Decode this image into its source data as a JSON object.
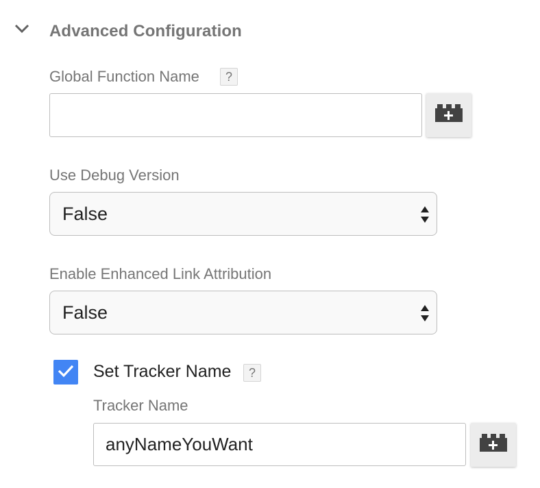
{
  "section": {
    "title": "Advanced Configuration",
    "toggle_icon": "chevron-down-icon"
  },
  "global_function": {
    "label": "Global Function Name",
    "help": "?",
    "value": "",
    "variable_button_icon": "add-variable-icon"
  },
  "debug_version": {
    "label": "Use Debug Version",
    "selected": "False"
  },
  "link_attribution": {
    "label": "Enable Enhanced Link Attribution",
    "selected": "False"
  },
  "set_tracker_name": {
    "checked": true,
    "label": "Set Tracker Name",
    "help": "?"
  },
  "tracker_name": {
    "label": "Tracker Name",
    "value": "anyNameYouWant",
    "variable_button_icon": "add-variable-icon"
  },
  "colors": {
    "accent": "#4285f4",
    "label_text": "#757575",
    "value_text": "#212121"
  }
}
